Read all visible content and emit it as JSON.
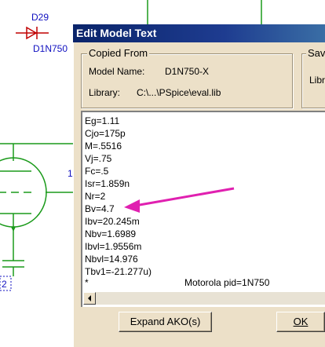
{
  "schematic": {
    "diode_ref": "D29",
    "diode_part": "D1N750",
    "pin_label": "1",
    "ground_label": "2"
  },
  "dialog": {
    "title": "Edit Model Text",
    "copied_from": {
      "heading": "Copied From",
      "model_name_label": "Model Name:",
      "model_name_value": "D1N750-X",
      "library_label": "Library:",
      "library_value": "C:\\...\\PSpice\\eval.lib"
    },
    "save_group": {
      "heading": "Sav",
      "library_label": "Libr"
    },
    "model_lines": [
      "Eg=1.11",
      "Cjo=175p",
      "M=.5516",
      "Vj=.75",
      "Fc=.5",
      "Isr=1.859n",
      "Nr=2",
      "Bv=4.7",
      "Ibv=20.245m",
      "Nbv=1.6989",
      "Ibvl=1.9556m",
      "Nbvl=14.976",
      "Tbv1=-21.277u)",
      "*"
    ],
    "comment_text": "Motorola   pid=1N750",
    "expand_button": "Expand AKO(s)",
    "ok_button": "OK"
  },
  "annotation": {
    "arrow_color": "#E020B0"
  },
  "colors": {
    "titlebar": "#0A246A",
    "dialog_bg": "#ECE0C8",
    "schematic_text": "#1010C0",
    "wire": "#1A9A1A"
  }
}
